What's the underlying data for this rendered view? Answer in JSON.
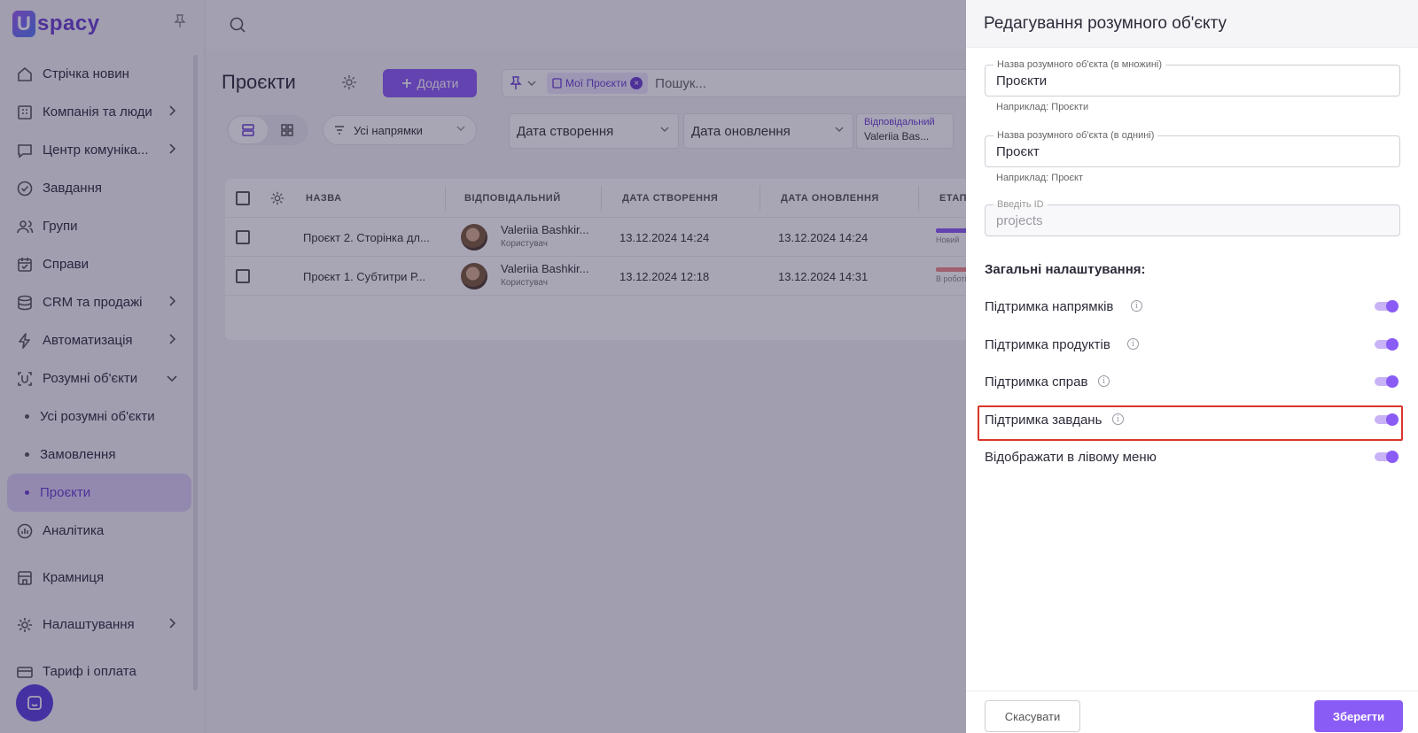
{
  "brand": {
    "logo_text": "spacy",
    "logo_letter": "U",
    "accent": "#8a5cf6"
  },
  "sidebar": {
    "items": [
      {
        "label": "Стрічка новин",
        "icon": "home-icon"
      },
      {
        "label": "Компанія та люди",
        "icon": "building-icon",
        "has_children": true
      },
      {
        "label": "Центр комуніка...",
        "icon": "message-icon",
        "has_children": true
      },
      {
        "label": "Завдання",
        "icon": "check-circle-icon"
      },
      {
        "label": "Групи",
        "icon": "users-icon"
      },
      {
        "label": "Справи",
        "icon": "calendar-icon"
      },
      {
        "label": "CRM та продажі",
        "icon": "coins-icon",
        "has_children": true
      },
      {
        "label": "Автоматизація",
        "icon": "lightning-icon",
        "has_children": true
      },
      {
        "label": "Розумні об'єкти",
        "icon": "smart-object-icon",
        "expanded": true
      },
      {
        "label": "Усі розумні об'єкти",
        "sub": true
      },
      {
        "label": "Замовлення",
        "sub": true
      },
      {
        "label": "Проєкти",
        "sub": true,
        "active": true
      },
      {
        "label": "Аналітика",
        "icon": "chart-icon"
      },
      {
        "label": "Крамниця",
        "icon": "store-icon"
      },
      {
        "label": "Налаштування",
        "icon": "gear-icon",
        "has_children": true
      },
      {
        "label": "Тариф і оплата",
        "icon": "card-icon"
      }
    ]
  },
  "main": {
    "title": "Проєкти",
    "add_button": "Додати",
    "filter_chip": "Мої Проєкти",
    "search_placeholder": "Пошук...",
    "direction_select": "Усі напрямки",
    "created_select": "Дата створення",
    "updated_select": "Дата оновлення",
    "responsible_caption": "Відповідальний",
    "responsible_value": "Valeriia Bas..."
  },
  "table": {
    "headers": [
      "НАЗВА",
      "ВІДПОВІДАЛЬНИЙ",
      "ДАТА СТВОРЕННЯ",
      "ДАТА ОНОВЛЕННЯ",
      "ЕТАП"
    ],
    "rows": [
      {
        "name": "Проєкт 2. Сторінка дл...",
        "user": "Valeriia Bashkir...",
        "role": "Користувач",
        "created": "13.12.2024 14:24",
        "updated": "13.12.2024 14:24",
        "stage": "Новий",
        "stage_color": "#8a5cf6"
      },
      {
        "name": "Проєкт 1. Субтитри Р...",
        "user": "Valeriia Bashkir...",
        "role": "Користувач",
        "created": "13.12.2024 12:18",
        "updated": "13.12.2024 14:31",
        "stage": "В роботі",
        "stage_color": "#f28b8b"
      }
    ]
  },
  "drawer": {
    "title": "Редагування розумного об'єкту",
    "plural_label": "Назва розумного об'єкта (в множині)",
    "plural_value": "Проєкти",
    "plural_hint": "Наприклад: Проєкти",
    "singular_label": "Назва розумного об'єкта (в однині)",
    "singular_value": "Проєкт",
    "singular_hint": "Наприклад: Проєкт",
    "id_label": "Введіть ID",
    "id_value": "projects",
    "section_title": "Загальні налаштування:",
    "toggles": [
      {
        "label": "Підтримка напрямків",
        "info": true,
        "on": true
      },
      {
        "label": "Підтримка продуктів",
        "info": true,
        "on": true
      },
      {
        "label": "Підтримка справ",
        "info": true,
        "on": true
      },
      {
        "label": "Підтримка завдань",
        "info": true,
        "on": true,
        "highlighted": true
      },
      {
        "label": "Відображати в лівому меню",
        "info": false,
        "on": true
      }
    ],
    "cancel": "Скасувати",
    "save": "Зберегти"
  }
}
